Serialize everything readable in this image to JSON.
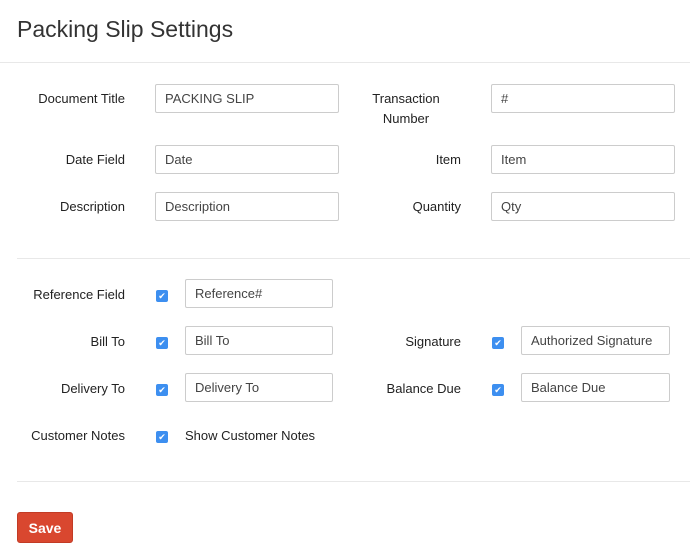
{
  "title": "Packing Slip Settings",
  "fields": {
    "document_title": {
      "label": "Document Title",
      "value": "PACKING SLIP"
    },
    "transaction_number": {
      "label": "Transaction Number",
      "value": "#"
    },
    "date_field": {
      "label": "Date Field",
      "value": "Date"
    },
    "item": {
      "label": "Item",
      "value": "Item"
    },
    "description": {
      "label": "Description",
      "value": "Description"
    },
    "quantity": {
      "label": "Quantity",
      "value": "Qty"
    }
  },
  "options": {
    "reference": {
      "label": "Reference Field",
      "checked": true,
      "value": "Reference#"
    },
    "bill_to": {
      "label": "Bill To",
      "checked": true,
      "value": "Bill To"
    },
    "delivery_to": {
      "label": "Delivery To",
      "checked": true,
      "value": "Delivery To"
    },
    "customer_notes": {
      "label": "Customer Notes",
      "checked": true,
      "text": "Show Customer Notes"
    },
    "signature": {
      "label": "Signature",
      "checked": true,
      "value": "Authorized Signature"
    },
    "balance_due": {
      "label": "Balance Due",
      "checked": true,
      "value": "Balance Due"
    }
  },
  "save_label": "Save",
  "colors": {
    "accent": "#d9472f",
    "checkbox": "#3d8ff0"
  }
}
